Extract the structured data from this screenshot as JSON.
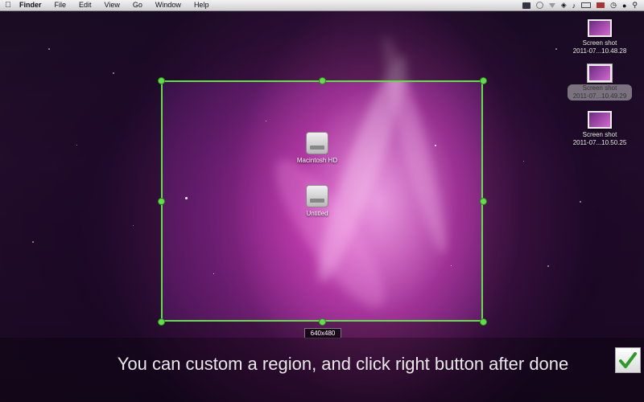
{
  "menubar": {
    "app_name": "Finder",
    "items": [
      "File",
      "Edit",
      "View",
      "Go",
      "Window",
      "Help"
    ]
  },
  "selection": {
    "size_label": "640x480",
    "border_color": "#5fe046"
  },
  "desktop_icons": [
    {
      "label": "Macintosh HD"
    },
    {
      "label": "Untitled"
    }
  ],
  "screenshots": [
    {
      "line1": "Screen shot",
      "line2": "2011-07...10.48.28"
    },
    {
      "line1": "Screen shot",
      "line2": "2011-07...10.49.29"
    },
    {
      "line1": "Screen shot",
      "line2": "2011-07...10.50.25"
    }
  ],
  "hint_text": "You can custom a region, and click right button after done",
  "done_button": {
    "icon": "checkmark-icon",
    "color": "#2f9a2a"
  }
}
